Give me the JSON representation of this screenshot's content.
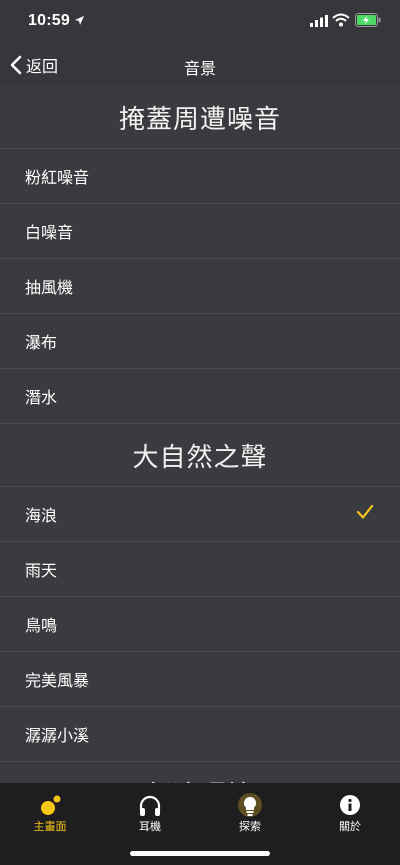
{
  "status_bar": {
    "time": "10:59"
  },
  "nav": {
    "back_label": "返回",
    "title": "音景"
  },
  "sections": [
    {
      "title": "掩蓋周遭噪音",
      "items": [
        "粉紅噪音",
        "白噪音",
        "抽風機",
        "瀑布",
        "潛水"
      ]
    },
    {
      "title": "大自然之聲",
      "items": [
        "海浪",
        "雨天",
        "鳥鳴",
        "完美風暴",
        "潺潺小溪"
      ]
    },
    {
      "title": "舒適環境"
    }
  ],
  "selected_item": "海浪",
  "tabs": [
    {
      "label": "主畫面",
      "icon": "home-dots-icon",
      "active": true
    },
    {
      "label": "耳機",
      "icon": "headphones-icon",
      "active": false
    },
    {
      "label": "探索",
      "icon": "lightbulb-icon",
      "active": false
    },
    {
      "label": "關於",
      "icon": "info-icon",
      "active": false
    }
  ],
  "colors": {
    "accent": "#f5c518",
    "background": "#3a3b3f",
    "tab_bar": "#1e1e20"
  }
}
